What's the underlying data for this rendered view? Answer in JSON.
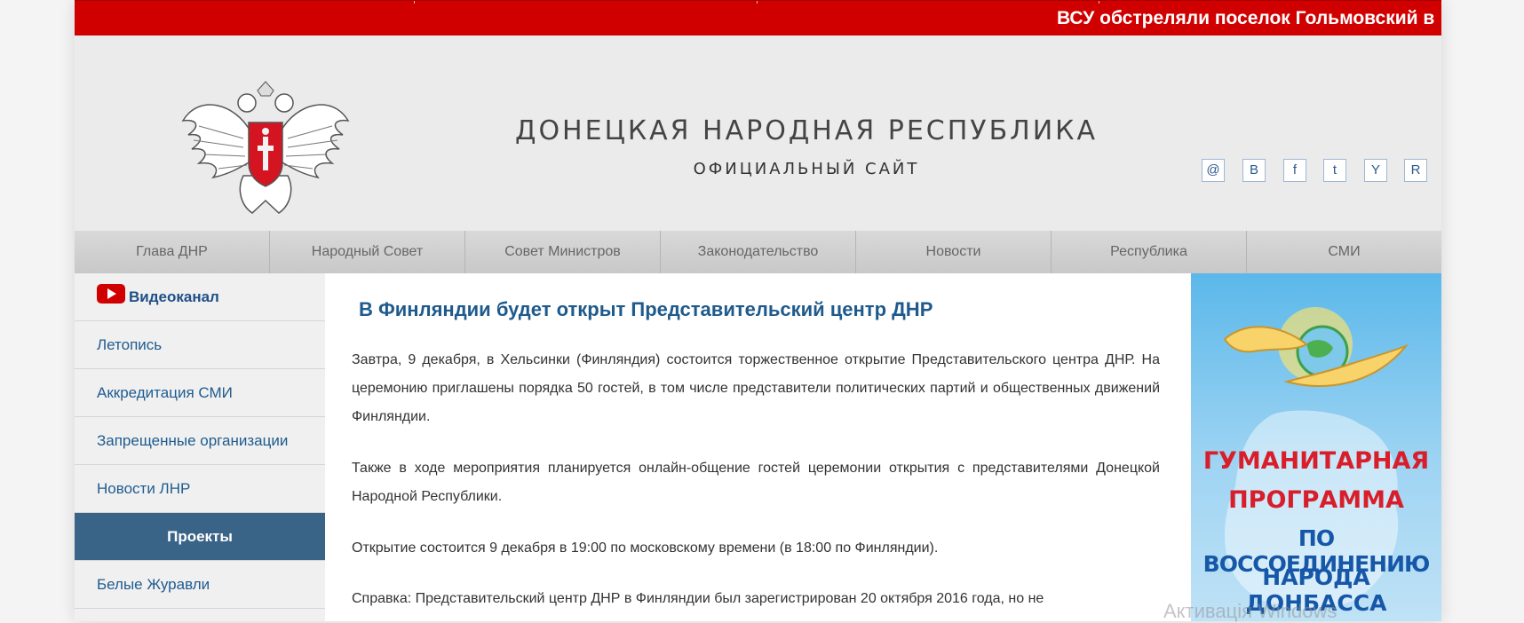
{
  "ticker": {
    "text": "ВСУ обстреляли поселок Гольмовский в"
  },
  "header": {
    "title": "ДОНЕЦКАЯ НАРОДНАЯ РЕСПУБЛИКА",
    "subtitle": "ОФИЦИАЛЬНЫЙ САЙТ",
    "social": [
      "@",
      "B",
      "f",
      "t",
      "Y",
      "R"
    ]
  },
  "nav": [
    "Глава ДНР",
    "Народный Совет",
    "Совет Министров",
    "Законодательство",
    "Новости",
    "Республика",
    "СМИ"
  ],
  "sidebar": {
    "video": "Видеоканал",
    "items": [
      "Летопись",
      "Аккредитация СМИ",
      "Запрещенные организации",
      "Новости ЛНР"
    ],
    "projects": "Проекты",
    "after": [
      "Белые Журавли"
    ]
  },
  "article": {
    "title": "В Финляндии будет открыт Представительский центр ДНР",
    "paragraphs": [
      "Завтра, 9 декабря, в Хельсинки (Финляндия) состоится торжественное открытие Представительского центра ДНР. На церемонию приглашены порядка 50 гостей, в том числе представители политических партий и общественных движений Финляндии.",
      "Также в ходе мероприятия планируется онлайн-общение гостей церемонии открытия с представителями Донецкой Народной Республики.",
      "Открытие состоится 9 декабря в 19:00 по московскому времени (в 18:00 по Финляндии).",
      "Справка: Представительский центр ДНР в Финляндии был зарегистрирован 20 октября 2016 года, но не"
    ]
  },
  "banner": {
    "lines": [
      "ГУМАНИТАРНАЯ",
      "ПРОГРАММА",
      "ПО ВОССОЕДИНЕНИЮ",
      "НАРОДА ДОНБАССА"
    ],
    "colors": {
      "red": "#d81e2a",
      "blue": "#1657a8"
    }
  },
  "watermark": "Активація Windows"
}
